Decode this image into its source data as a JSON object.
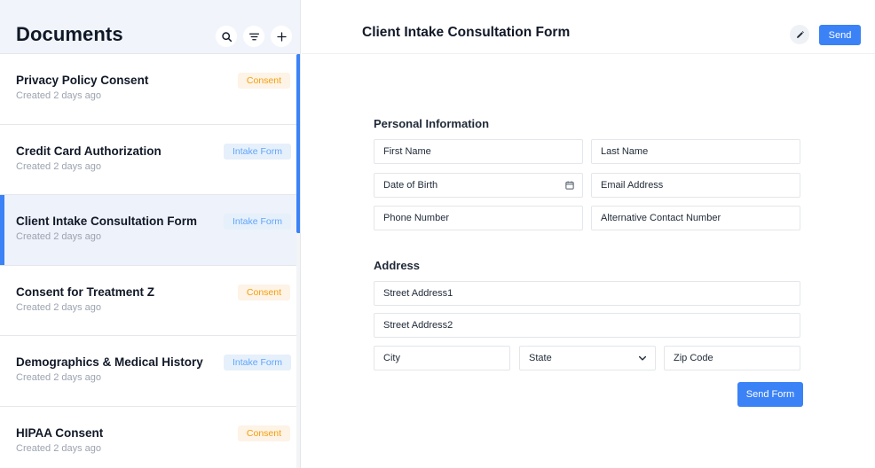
{
  "sidebar": {
    "title": "Documents",
    "items": [
      {
        "title": "Privacy Policy Consent",
        "subtitle": "Created 2 days ago",
        "badge": "Consent",
        "badge_type": "consent"
      },
      {
        "title": "Credit Card Authorization",
        "subtitle": "Created 2 days ago",
        "badge": "Intake Form",
        "badge_type": "intake"
      },
      {
        "title": "Client Intake Consultation Form",
        "subtitle": "Created 2 days ago",
        "badge": "Intake Form",
        "badge_type": "intake"
      },
      {
        "title": "Consent for Treatment Z",
        "subtitle": "Created 2 days ago",
        "badge": "Consent",
        "badge_type": "consent"
      },
      {
        "title": "Demographics & Medical History",
        "subtitle": "Created 2 days ago",
        "badge": "Intake Form",
        "badge_type": "intake"
      },
      {
        "title": "HIPAA Consent",
        "subtitle": "Created 2 days ago",
        "badge": "Consent",
        "badge_type": "consent"
      }
    ],
    "active_index": 2,
    "icons": [
      "search-icon",
      "filter-icon",
      "plus-icon"
    ]
  },
  "main": {
    "title": "Client Intake Consultation Form",
    "send_label": "Send",
    "edit_icon": "pencil-icon",
    "form": {
      "personal_title": "Personal Information",
      "first_name": "First Name",
      "last_name": "Last Name",
      "dob": "Date of Birth",
      "email": "Email Address",
      "phone": "Phone Number",
      "alt_phone": "Alternative Contact Number",
      "address_title": "Address",
      "street1": "Street Address1",
      "street2": "Street Address2",
      "city": "City",
      "state": "State",
      "zip": "Zip Code",
      "submit_label": "Send Form"
    }
  },
  "colors": {
    "accent": "#3b82f6",
    "consent_badge_bg": "#fdf3e6",
    "consent_badge_text": "#f59e0b",
    "intake_badge_bg": "#e6f0fb",
    "intake_badge_text": "#60a5fa",
    "active_row_bg": "#eef2fb"
  }
}
